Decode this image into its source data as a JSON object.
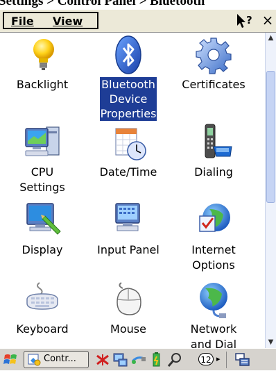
{
  "window": {
    "title": "Settings > Control Panel > Bluetooth"
  },
  "menubar": {
    "file": "File",
    "view": "View",
    "help_icon": "help-pointer-icon",
    "close": "×"
  },
  "items": [
    {
      "id": "backlight",
      "label": "Backlight",
      "icon": "lightbulb-icon",
      "selected": false
    },
    {
      "id": "bluetooth",
      "label_lines": [
        "Bluetooth",
        "Device",
        "Properties"
      ],
      "icon": "bluetooth-icon",
      "selected": true
    },
    {
      "id": "certificates",
      "label": "Certificates",
      "icon": "gear-icon",
      "selected": false
    },
    {
      "id": "cpu",
      "label_lines": [
        "CPU",
        "Settings"
      ],
      "icon": "computer-icon",
      "selected": false
    },
    {
      "id": "datetime",
      "label": "Date/Time",
      "icon": "calendar-clock-icon",
      "selected": false
    },
    {
      "id": "dialing",
      "label": "Dialing",
      "icon": "phone-icon",
      "selected": false
    },
    {
      "id": "display",
      "label": "Display",
      "icon": "display-icon",
      "selected": false
    },
    {
      "id": "inputpanel",
      "label": "Input Panel",
      "icon": "input-panel-icon",
      "selected": false
    },
    {
      "id": "internet",
      "label_lines": [
        "Internet",
        "Options"
      ],
      "icon": "globe-check-icon",
      "selected": false
    },
    {
      "id": "keyboard",
      "label": "Keyboard",
      "icon": "keyboard-icon",
      "selected": false
    },
    {
      "id": "mouse",
      "label": "Mouse",
      "icon": "mouse-icon",
      "selected": false
    },
    {
      "id": "network",
      "label_lines": [
        "Network",
        "and Dial"
      ],
      "icon": "network-globe-icon",
      "selected": false
    }
  ],
  "taskbar": {
    "task_label": "Contr...",
    "badge": "12",
    "arrow": "▸"
  },
  "colors": {
    "selection": "#1e3d96",
    "menubar": "#ece9d8",
    "taskbar": "#d6d3ce",
    "scroll_thumb": "#c6d4f4"
  }
}
